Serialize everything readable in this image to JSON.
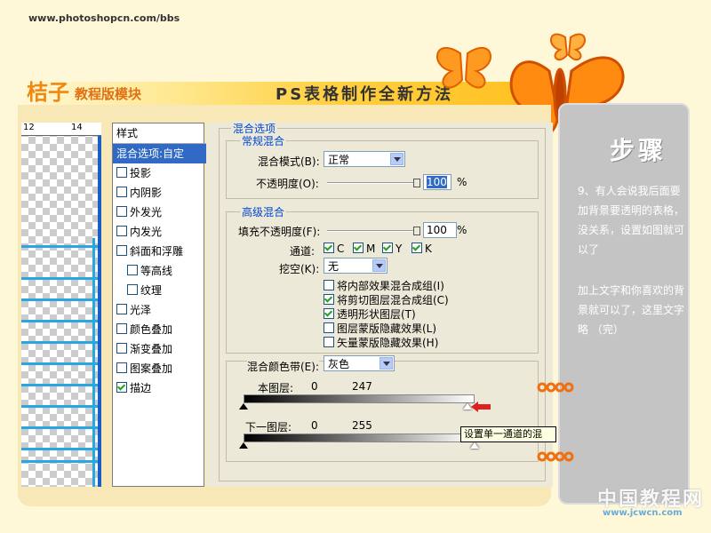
{
  "site": {
    "url": "www.photoshopcn.com/bbs",
    "logo_main": "桔子",
    "logo_sub": "教程版模块",
    "page_title": "PS表格制作全新方法"
  },
  "ruler": {
    "marks": [
      "12",
      "14"
    ]
  },
  "styles_panel": {
    "header": "样式",
    "items": [
      {
        "label": "混合选项:自定",
        "checkbox": false,
        "checked": false,
        "selected": true,
        "indent": false
      },
      {
        "label": "投影",
        "checkbox": true,
        "checked": false,
        "selected": false,
        "indent": false
      },
      {
        "label": "内阴影",
        "checkbox": true,
        "checked": false,
        "selected": false,
        "indent": false
      },
      {
        "label": "外发光",
        "checkbox": true,
        "checked": false,
        "selected": false,
        "indent": false
      },
      {
        "label": "内发光",
        "checkbox": true,
        "checked": false,
        "selected": false,
        "indent": false
      },
      {
        "label": "斜面和浮雕",
        "checkbox": true,
        "checked": false,
        "selected": false,
        "indent": false
      },
      {
        "label": "等高线",
        "checkbox": true,
        "checked": false,
        "selected": false,
        "indent": true
      },
      {
        "label": "纹理",
        "checkbox": true,
        "checked": false,
        "selected": false,
        "indent": true
      },
      {
        "label": "光泽",
        "checkbox": true,
        "checked": false,
        "selected": false,
        "indent": false
      },
      {
        "label": "颜色叠加",
        "checkbox": true,
        "checked": false,
        "selected": false,
        "indent": false
      },
      {
        "label": "渐变叠加",
        "checkbox": true,
        "checked": false,
        "selected": false,
        "indent": false
      },
      {
        "label": "图案叠加",
        "checkbox": true,
        "checked": false,
        "selected": false,
        "indent": false
      },
      {
        "label": "描边",
        "checkbox": true,
        "checked": true,
        "selected": false,
        "indent": false
      }
    ]
  },
  "blending": {
    "title": "混合选项",
    "general": {
      "legend": "常规混合",
      "mode_label": "混合模式(B):",
      "mode_value": "正常",
      "opacity_label": "不透明度(O):",
      "opacity_value": "100",
      "opacity_unit": "%",
      "opacity_level": 1.0
    },
    "advanced": {
      "legend": "高级混合",
      "fill_label": "填充不透明度(F):",
      "fill_value": "100",
      "fill_unit": "%",
      "fill_level": 1.0,
      "channels_label": "通道:",
      "channels": [
        {
          "label": "C",
          "checked": true
        },
        {
          "label": "M",
          "checked": true
        },
        {
          "label": "Y",
          "checked": true
        },
        {
          "label": "K",
          "checked": true
        }
      ],
      "knockout_label": "挖空(K):",
      "knockout_value": "无",
      "options": [
        {
          "label": "将内部效果混合成组(I)",
          "checked": false
        },
        {
          "label": "将剪切图层混合成组(C)",
          "checked": true
        },
        {
          "label": "透明形状图层(T)",
          "checked": true
        },
        {
          "label": "图层蒙版隐藏效果(L)",
          "checked": false
        },
        {
          "label": "矢量蒙版隐藏效果(H)",
          "checked": false
        }
      ]
    },
    "blend_if": {
      "label": "混合颜色带(E):",
      "value": "灰色",
      "this_layer_label": "本图层:",
      "this_layer_low": "0",
      "this_layer_high": "247",
      "this_layer_low_level": 0,
      "this_layer_high_level": 247,
      "under_layer_label": "下一图层:",
      "under_layer_low": "0",
      "under_layer_high": "255",
      "under_layer_low_level": 0,
      "under_layer_high_level": 255,
      "tooltip": "设置单一通道的混"
    }
  },
  "side_panel": {
    "title": "步骤",
    "para1": "9、有人会说我后面要加背景要透明的表格，没关系，设置如图就可以了",
    "para2": "加上文字和你喜欢的背景就可以了，这里文字略 （完）"
  },
  "watermark": {
    "cn": "中国教程网",
    "url": "www.jcwcn.com"
  },
  "colors": {
    "accent_orange": "#f08810",
    "selection_blue": "#316ac5",
    "table_line_blue": "#29a7e0"
  }
}
